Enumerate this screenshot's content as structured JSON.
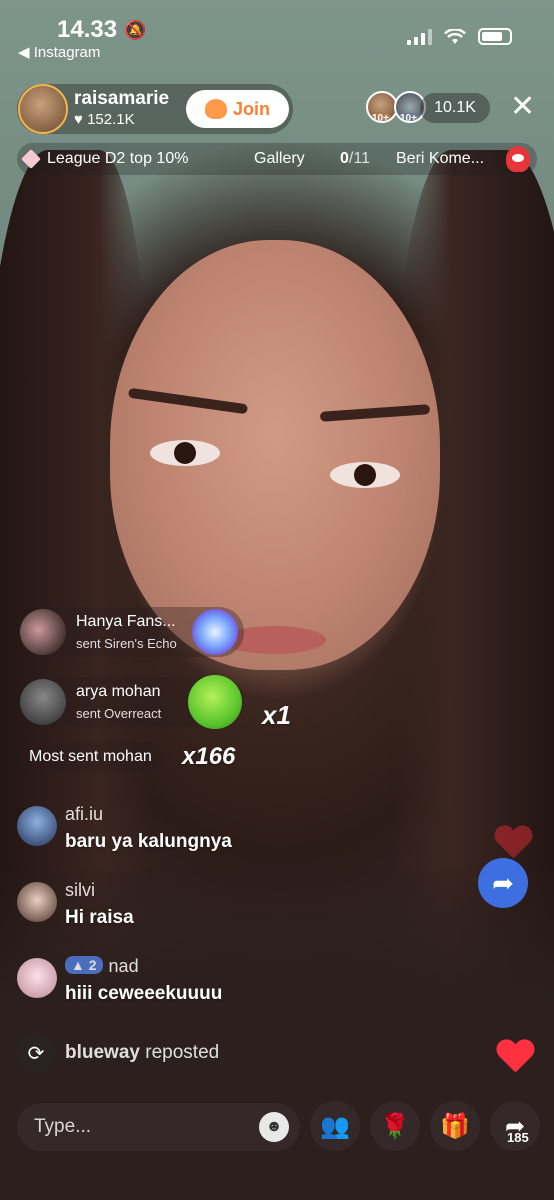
{
  "status_bar": {
    "time": "14.33",
    "back_app": "Instagram"
  },
  "host": {
    "username": "raisamarie",
    "likes": "152.1K",
    "join_label": "Join"
  },
  "viewers": {
    "badge_1": "10+",
    "badge_2": "10+",
    "count": "10.1K"
  },
  "info_bar": {
    "league": "League D2 top 10%",
    "gallery_label": "Gallery",
    "gallery_current": "0",
    "gallery_total": "/11",
    "comment_task": "Beri Kome..."
  },
  "gifts": [
    {
      "user": "Hanya Fans...",
      "action": "sent Siren's Echo"
    },
    {
      "user": "arya mohan",
      "action": "sent Overreact",
      "multiplier": "x1"
    }
  ],
  "most_sent": {
    "prefix": "Most sent",
    "user": "mohan",
    "multiplier": "x166"
  },
  "comments": [
    {
      "user": "afi.iu",
      "text": "baru ya kalungnya"
    },
    {
      "user": "silvi",
      "text": "Hi raisa"
    },
    {
      "level": "2",
      "user": "nad",
      "text": "hiii ceweeekuuuu"
    }
  ],
  "repost": {
    "user": "blueway",
    "action": "reposted"
  },
  "bottom_bar": {
    "placeholder": "Type...",
    "share_count": "185"
  },
  "colors": {
    "join": "#ff7e2e",
    "heart": "#ff3040",
    "share": "#3d6fe0",
    "level_badge": "#4f7bdc"
  },
  "icons": [
    "bell-slash-icon",
    "signal-icon",
    "wifi-icon",
    "battery-icon",
    "heart-icon",
    "close-icon",
    "diamond-icon",
    "repost-icon",
    "share-icon",
    "emoji-icon",
    "people-icon",
    "rose-icon",
    "gift-icon"
  ]
}
